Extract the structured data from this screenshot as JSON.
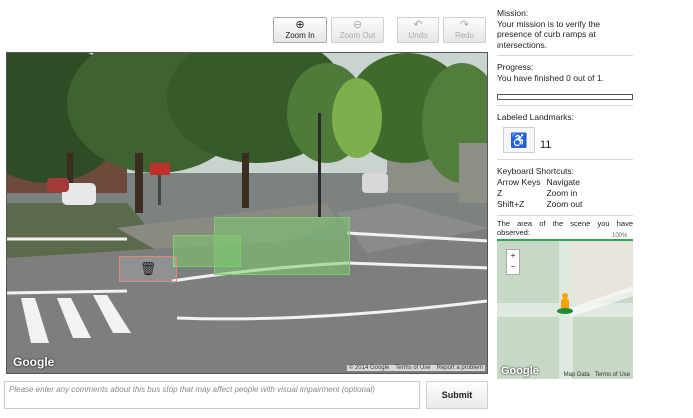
{
  "toolbar": {
    "zoom_in": {
      "label": "Zoom In",
      "icon": "zoom-in-icon",
      "glyph": "⊕"
    },
    "zoom_out": {
      "label": "Zoom Out",
      "icon": "zoom-out-icon",
      "glyph": "⊖"
    },
    "undo": {
      "label": "Undo",
      "icon": "undo-icon",
      "glyph": "↶"
    },
    "redo": {
      "label": "Redo",
      "icon": "redo-icon",
      "glyph": "↷"
    }
  },
  "pano": {
    "google_logo": "Google",
    "copyright": "© 2014 Google",
    "terms": "Terms of Use",
    "report": "Report a problem"
  },
  "mission": {
    "heading": "Mission:",
    "text": "Your mission is to verify the presence of curb ramps at intersections."
  },
  "progress": {
    "heading": "Progress:",
    "text": "You have finished 0 out of 1.",
    "fraction": 0
  },
  "landmarks": {
    "heading": "Labeled Landmarks:",
    "icon": "curb-ramp-icon",
    "count": "11"
  },
  "shortcuts": {
    "heading": "Keyboard Shortcuts:",
    "rows": [
      {
        "key": "Arrow Keys",
        "action": "Navigate"
      },
      {
        "key": "Z",
        "action": "Zoom in"
      },
      {
        "key": "Shift+Z",
        "action": "Zoom out"
      }
    ]
  },
  "observed": {
    "text": "The area of the scene you have observed:",
    "percent_label": "100%",
    "fraction": 1.0
  },
  "minimap": {
    "google_logo": "Google",
    "map_data": "Map Data",
    "terms": "Terms of Use"
  },
  "comment": {
    "placeholder": "Please enter any comments about this bus stop that may affect people with visual impairment (optional)",
    "value": ""
  },
  "submit_label": "Submit",
  "colors": {
    "label_green": "#7ecb6f",
    "progress_fill": "#2fa84f",
    "trash_red": "#e8857a"
  }
}
